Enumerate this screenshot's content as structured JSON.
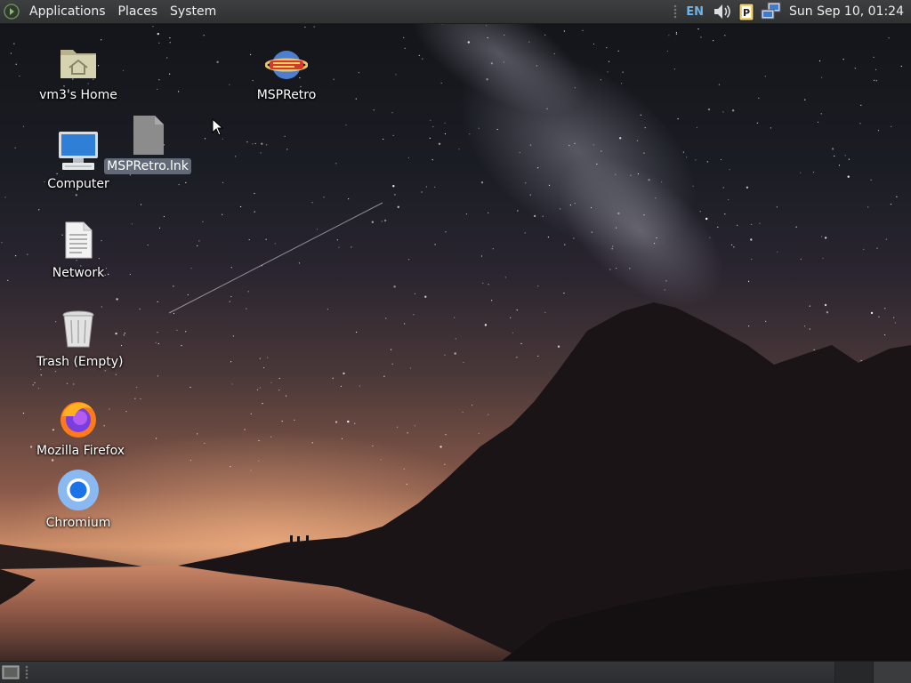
{
  "top_panel": {
    "menus": [
      "Applications",
      "Places",
      "System"
    ],
    "language": "EN",
    "clock": "Sun Sep 10, 01:24",
    "tray_icons": [
      "volume-icon",
      "clipboard-parcellite-icon",
      "network-icon"
    ]
  },
  "desktop_icons": [
    {
      "label": "vm3's Home",
      "icon": "home-folder-icon"
    },
    {
      "label": "Computer",
      "icon": "computer-icon"
    },
    {
      "label": "Network",
      "icon": "network-file-icon"
    },
    {
      "label": "Trash (Empty)",
      "icon": "trash-icon"
    },
    {
      "label": "Mozilla Firefox",
      "icon": "firefox-icon"
    },
    {
      "label": "Chromium",
      "icon": "chromium-icon"
    },
    {
      "label": "MSPRetro",
      "icon": "msp-planet-icon"
    },
    {
      "label": "MSPRetro.lnk",
      "icon": "generic-file-icon"
    }
  ],
  "bottom_panel": {
    "workspaces": 2,
    "active_workspace": 1
  },
  "colors": {
    "panel": "#2f3132",
    "language_indicator": "#6fb3e8",
    "selection": "#6e7887"
  }
}
